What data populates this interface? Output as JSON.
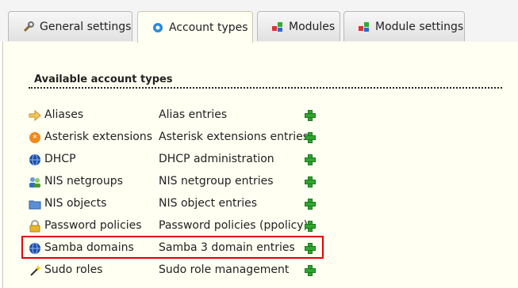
{
  "tabs": [
    {
      "label": "General settings",
      "icon": "wrench-icon"
    },
    {
      "label": "Account types",
      "icon": "gear-icon"
    },
    {
      "label": "Modules",
      "icon": "modules-icon"
    },
    {
      "label": "Module settings",
      "icon": "modules-icon"
    }
  ],
  "active_tab": "Account types",
  "section_title": "Available account types",
  "account_types": [
    {
      "name": "Aliases",
      "description": "Alias entries",
      "icon": "arrow-icon"
    },
    {
      "name": "Asterisk extensions",
      "description": "Asterisk extensions entries",
      "icon": "asterisk-icon"
    },
    {
      "name": "DHCP",
      "description": "DHCP administration",
      "icon": "globe-icon"
    },
    {
      "name": "NIS netgroups",
      "description": "NIS netgroup entries",
      "icon": "users-icon"
    },
    {
      "name": "NIS objects",
      "description": "NIS object entries",
      "icon": "folder-icon"
    },
    {
      "name": "Password policies",
      "description": "Password policies (ppolicy)",
      "icon": "lock-icon"
    },
    {
      "name": "Samba domains",
      "description": "Samba 3 domain entries",
      "icon": "globe-icon"
    },
    {
      "name": "Sudo roles",
      "description": "Sudo role management",
      "icon": "wand-icon"
    }
  ],
  "highlighted_row": "Samba domains",
  "colors": {
    "panel_bg": "#fffff2",
    "highlight": "#e00000",
    "add_green": "#2fa52f"
  }
}
